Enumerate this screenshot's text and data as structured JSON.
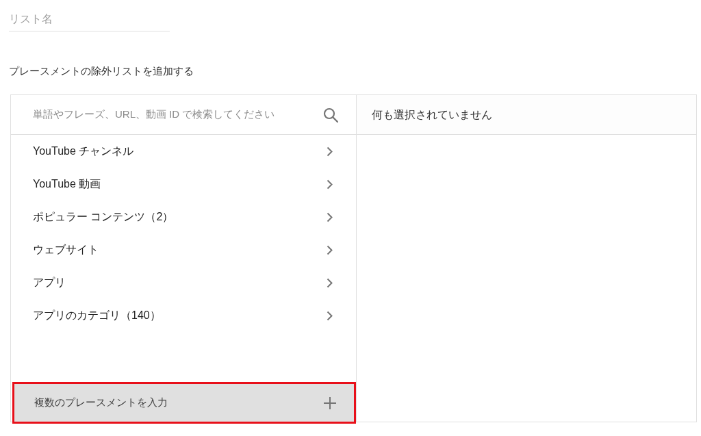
{
  "list_name_field": {
    "placeholder": "リスト名"
  },
  "heading": "プレースメントの除外リストを追加する",
  "search": {
    "placeholder": "単語やフレーズ、URL、動画 ID で検索してください"
  },
  "categories": [
    {
      "label": "YouTube チャンネル"
    },
    {
      "label": "YouTube 動画"
    },
    {
      "label": "ポピュラー コンテンツ（2）"
    },
    {
      "label": "ウェブサイト"
    },
    {
      "label": "アプリ"
    },
    {
      "label": "アプリのカテゴリ（140）"
    }
  ],
  "add_multiple_button": {
    "label": "複数のプレースメントを入力",
    "highlighted": true
  },
  "selection_panel": {
    "empty_message": "何も選択されていません"
  }
}
